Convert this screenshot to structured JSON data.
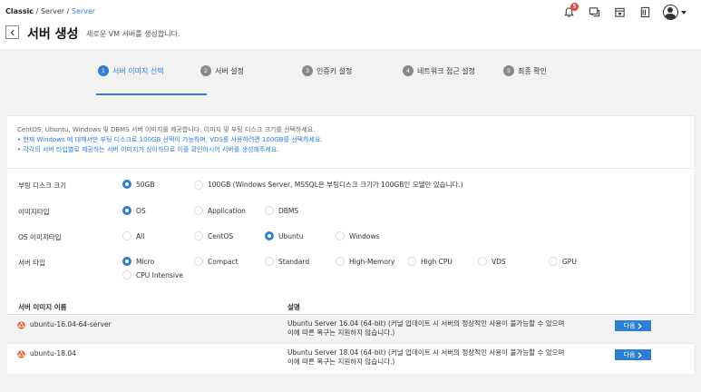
{
  "breadcrumb": {
    "items": [
      "Classic",
      "Server",
      "Server"
    ],
    "separator": "/"
  },
  "header": {
    "title": "서버 생성",
    "subtitle": "새로운 VM 서버를 생성합니다."
  },
  "notifications": {
    "count": "5"
  },
  "colors": {
    "accent": "#2d7fd3",
    "badge": "#e8443a",
    "ubuntu": "#e95420"
  },
  "steps": [
    {
      "num": "1",
      "label": "서버 이미지 선택",
      "active": true
    },
    {
      "num": "2",
      "label": "서버 설정",
      "active": false
    },
    {
      "num": "3",
      "label": "인증키 설정",
      "active": false
    },
    {
      "num": "4",
      "label": "네트워크 접근 설정",
      "active": false
    },
    {
      "num": "5",
      "label": "최종 확인",
      "active": false
    }
  ],
  "info": {
    "intro": "CentOS, Ubuntu, Windows 및 DBMS 서버 이미지를 제공합니다. 이미지 및 부팅 디스크 크기를 선택하세요.",
    "bullet1": "• 현재 Windows 에 대해서만 부팅 디스크로 100GB 선택이 가능하며, VDS를 사용하려면 100GB를 선택하세요.",
    "bullet2": "• 각각의 서버 타입별로 제공하는 서버 이미지가 상이하므로 이를 확인하시어 서버를 생성해주세요."
  },
  "form": {
    "boot_disk": {
      "label": "부팅 디스크 크기",
      "options": [
        "50GB",
        "100GB (Windows Server, MSSQL은 부팅디스크 크기가 100GB인 모델만 있습니다.)"
      ],
      "selected": "50GB"
    },
    "image_type": {
      "label": "이미지타입",
      "options": [
        "OS",
        "Application",
        "DBMS"
      ],
      "selected": "OS"
    },
    "os_image_type": {
      "label": "OS 이미지타입",
      "options": [
        "All",
        "CentOS",
        "Ubuntu",
        "Windows"
      ],
      "selected": "Ubuntu"
    },
    "server_type": {
      "label": "서버 타입",
      "options": [
        "Micro",
        "Compact",
        "Standard",
        "High-Memory",
        "High CPU",
        "VDS",
        "GPU",
        "CPU Intensive"
      ],
      "selected": "Micro"
    }
  },
  "table": {
    "headers": [
      "서버 이미지 이름",
      "설명"
    ],
    "rows": [
      {
        "name": "ubuntu-16.04-64-server",
        "desc": "Ubuntu Server 16.04 (64-bit) (커널 업데이트 시 서버의 정상적인 사용이 불가능할 수 있으며 이에 따른 복구는 지원하지 않습니다.)",
        "action": "다음"
      },
      {
        "name": "ubuntu-18.04",
        "desc": "Ubuntu Server 18.04 (64-bit) (커널 업데이트 시 서버의 정상적인 사용이 불가능할 수 있으며 이에 따른 복구는 지원하지 않습니다.)",
        "action": "다음"
      }
    ]
  }
}
